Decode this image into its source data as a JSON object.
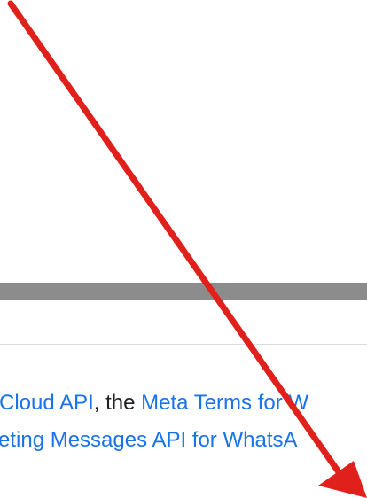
{
  "content": {
    "line1": {
      "link_cloud_api": "Cloud API",
      "text_comma_the": ", the ",
      "link_meta_terms": "Meta Terms for W"
    },
    "line2": {
      "link_marketing_messages": "eting Messages API for WhatsA"
    }
  },
  "annotation": {
    "arrow_color": "#e0201b",
    "icon": "red-arrow-icon"
  },
  "colors": {
    "link": "#1a73e8",
    "text": "#202124",
    "bar": "#8c8c8c",
    "divider": "#dadce0"
  }
}
